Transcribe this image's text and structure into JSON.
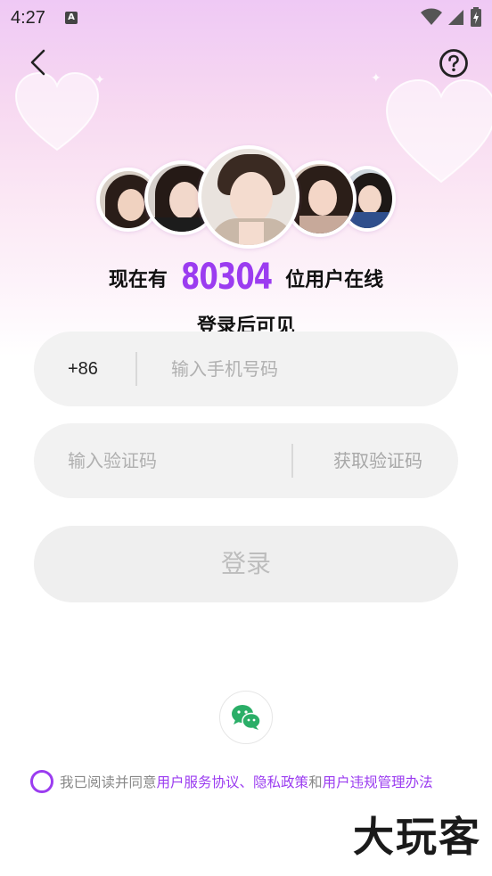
{
  "status_bar": {
    "time": "4:27",
    "icons": [
      "notification-a-icon",
      "wifi-icon",
      "signal-icon",
      "battery-charging-icon"
    ]
  },
  "header": {
    "back_icon": "chevron-left-icon",
    "help_icon": "question-circle-icon"
  },
  "hero": {
    "online_prefix": "现在有",
    "online_count": "80304",
    "online_suffix": "位用户在线",
    "subtitle": "登录后可见"
  },
  "phone_field": {
    "country_code": "+86",
    "placeholder": "输入手机号码",
    "value": ""
  },
  "code_field": {
    "placeholder": "输入验证码",
    "value": "",
    "get_code_label": "获取验证码"
  },
  "login_button": {
    "label": "登录"
  },
  "social_login": {
    "icon": "wechat-icon"
  },
  "agreement": {
    "prefix": "我已阅读并同意",
    "link1": "用户服务协议",
    "sep": "、",
    "link2": "隐私政策",
    "and": "和",
    "link3": "用户违规管理办法",
    "checked": false
  },
  "watermark": {
    "text": "大玩客"
  },
  "colors": {
    "accent": "#9b3cf0",
    "field_bg": "#f2f2f2",
    "wechat_green": "#2aae67"
  }
}
